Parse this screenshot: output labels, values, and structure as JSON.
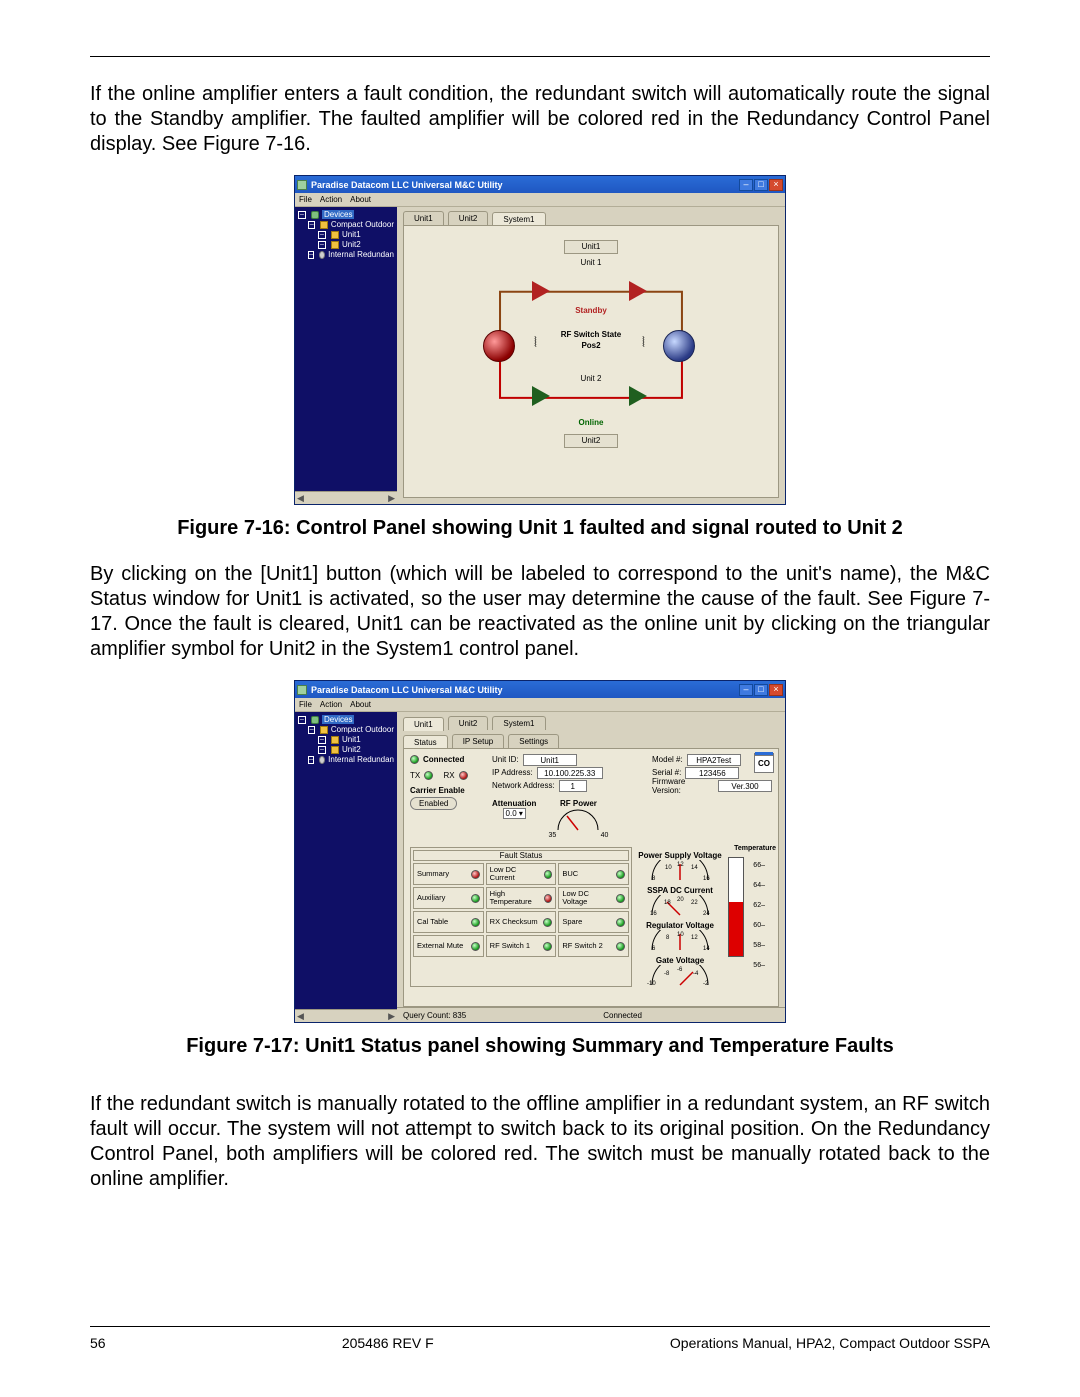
{
  "para1": "If the online amplifier enters a fault condition, the redundant switch will automatically route the signal to the Standby amplifier. The faulted amplifier will be colored red in the Redundancy Control Panel display. See Figure 7-16.",
  "caption16": "Figure 7-16: Control Panel showing Unit 1 faulted and signal routed to Unit 2",
  "para2": "By clicking on the [Unit1] button (which will be labeled to correspond to the unit's name), the M&C Status window for Unit1 is activated, so the user may determine the cause of the fault. See Figure 7-17. Once the fault is cleared, Unit1 can be reactivated as the online unit by clicking on the triangular amplifier symbol for Unit2 in the System1 control panel.",
  "caption17": "Figure 7-17: Unit1 Status panel showing Summary and Temperature Faults",
  "para3": "If the redundant switch is manually rotated to the offline amplifier in a redundant system, an RF switch fault will occur. The system will not attempt to switch back to its original position. On the Redundancy Control Panel, both amplifiers will be colored red. The switch must be manually rotated back to the online amplifier.",
  "footer": {
    "page": "56",
    "doc": "205486 REV F",
    "manual": "Operations Manual, HPA2, Compact Outdoor SSPA"
  },
  "win": {
    "title": "Paradise Datacom LLC Universal M&C Utility",
    "menu": {
      "file": "File",
      "action": "Action",
      "about": "About"
    },
    "tree": {
      "devices": "Devices",
      "compact": "Compact Outdoor",
      "unit1": "Unit1",
      "unit2": "Unit2",
      "intred": "Internal Redundan"
    }
  },
  "fig16": {
    "tabs": {
      "u1": "Unit1",
      "u2": "Unit2",
      "sys": "System1"
    },
    "btn_unit1": "Unit1",
    "btn_unit2": "Unit2",
    "lbl_unit1": "Unit 1",
    "lbl_unit2": "Unit 2",
    "standby": "Standby",
    "online": "Online",
    "rfswitch": "RF Switch State",
    "pos": "Pos2"
  },
  "fig17": {
    "tabs": {
      "u1": "Unit1",
      "u2": "Unit2",
      "sys": "System1"
    },
    "subtabs": {
      "status": "Status",
      "ip": "IP Setup",
      "settings": "Settings"
    },
    "connected": "Connected",
    "tx": "TX",
    "rx": "RX",
    "unitid_l": "Unit ID:",
    "unitid": "Unit1",
    "ip_l": "IP Address:",
    "ip": "10.100.225.33",
    "na_l": "Network Address:",
    "na": "1",
    "model_l": "Model #:",
    "model": "HPA2Test",
    "serial_l": "Serial #:",
    "serial": "123456",
    "fw_l": "Firmware Version:",
    "fw": "Ver.300",
    "co": "CO",
    "carrier_en": "Carrier Enable",
    "enabled": "Enabled",
    "atten": "Attenuation",
    "atten_v": "0.0",
    "rfpower": "RF Power",
    "rf_lo": "35",
    "rf_hi": "40",
    "fault_title": "Fault Status",
    "faults": {
      "summary": "Summary",
      "lowdccur": "Low DC Current",
      "buc": "BUC",
      "aux": "Auxiliary",
      "hitemp": "High Temperature",
      "lowdcvol": "Low DC Voltage",
      "caltable": "Cal Table",
      "rxchk": "RX Checksum",
      "spare": "Spare",
      "extmute": "External Mute",
      "rfsw1": "RF Switch 1",
      "rfsw2": "RF Switch 2"
    },
    "psv": "Power Supply Voltage",
    "sspa": "SSPA DC Current",
    "regv": "Regulator Voltage",
    "gatev": "Gate Voltage",
    "temp": "Temperature",
    "temp_ticks": {
      "t66": "66",
      "t64": "64",
      "t62": "62",
      "t60": "60",
      "t58": "58",
      "t56": "56"
    },
    "status": {
      "query": "Query Count: 835",
      "conn": "Connected"
    }
  }
}
